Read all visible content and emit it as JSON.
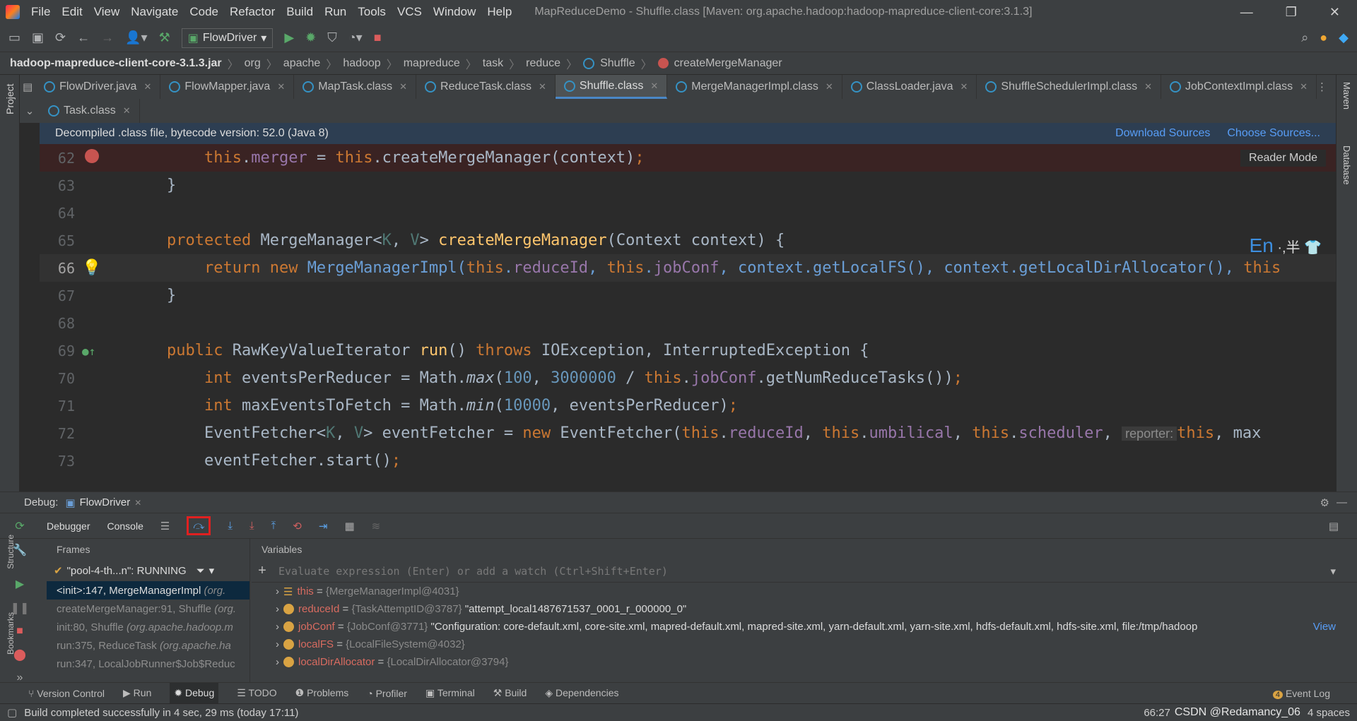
{
  "app": {
    "title": "MapReduceDemo - Shuffle.class [Maven: org.apache.hadoop:hadoop-mapreduce-client-core:3.1.3]",
    "menu": [
      "File",
      "Edit",
      "View",
      "Navigate",
      "Code",
      "Refactor",
      "Build",
      "Run",
      "Tools",
      "VCS",
      "Window",
      "Help"
    ]
  },
  "toolbar": {
    "run_config": "FlowDriver"
  },
  "breadcrumb": [
    "hadoop-mapreduce-client-core-3.1.3.jar",
    "org",
    "apache",
    "hadoop",
    "mapreduce",
    "task",
    "reduce",
    "Shuffle",
    "createMergeManager"
  ],
  "tabs": [
    {
      "label": "FlowDriver.java"
    },
    {
      "label": "FlowMapper.java"
    },
    {
      "label": "MapTask.class"
    },
    {
      "label": "ReduceTask.class"
    },
    {
      "label": "Shuffle.class",
      "active": true
    },
    {
      "label": "MergeManagerImpl.class"
    },
    {
      "label": "ClassLoader.java"
    },
    {
      "label": "ShuffleSchedulerImpl.class"
    },
    {
      "label": "JobContextImpl.class"
    }
  ],
  "tabs_row2": [
    {
      "label": "Task.class"
    }
  ],
  "info": {
    "text": "Decompiled .class file, bytecode version: 52.0 (Java 8)",
    "download": "Download Sources",
    "choose": "Choose Sources...",
    "reader": "Reader Mode"
  },
  "side": {
    "project": "Project",
    "maven": "Maven",
    "database": "Database",
    "structure": "Structure",
    "bookmarks": "Bookmarks"
  },
  "editor": {
    "ime": "En",
    "line_numbers": [
      "62",
      "63",
      "64",
      "65",
      "66",
      "67",
      "68",
      "69",
      "70",
      "71",
      "72",
      "73"
    ]
  },
  "debug": {
    "label": "Debug:",
    "session": "FlowDriver",
    "tab_debugger": "Debugger",
    "tab_console": "Console",
    "frames_label": "Frames",
    "variables_label": "Variables",
    "thread": "\"pool-4-th...n\": RUNNING",
    "frames": [
      {
        "method": "<init>:147, MergeManagerImpl",
        "pkg": "(org."
      },
      {
        "method": "createMergeManager:91, Shuffle",
        "pkg": "(org."
      },
      {
        "method": "init:80, Shuffle",
        "pkg": "(org.apache.hadoop.m"
      },
      {
        "method": "run:375, ReduceTask",
        "pkg": "(org.apache.ha"
      },
      {
        "method": "run:347, LocalJobRunner$Job$Reduc",
        "pkg": ""
      }
    ],
    "watch_placeholder": "Evaluate expression (Enter) or add a watch (Ctrl+Shift+Enter)",
    "variables": [
      {
        "name": "this",
        "eq": "=",
        "type": "{MergeManagerImpl@4031}",
        "value": ""
      },
      {
        "name": "reduceId",
        "eq": "=",
        "type": "{TaskAttemptID@3787}",
        "value": "\"attempt_local1487671537_0001_r_000000_0\""
      },
      {
        "name": "jobConf",
        "eq": "=",
        "type": "{JobConf@3771}",
        "value": "\"Configuration: core-default.xml, core-site.xml, mapred-default.xml, mapred-site.xml, yarn-default.xml, yarn-site.xml, hdfs-default.xml, hdfs-site.xml, file:/tmp/hadoop"
      },
      {
        "name": "localFS",
        "eq": "=",
        "type": "{LocalFileSystem@4032}",
        "value": ""
      },
      {
        "name": "localDirAllocator",
        "eq": "=",
        "type": "{LocalDirAllocator@3794}",
        "value": ""
      }
    ],
    "view_link": "View"
  },
  "bottom_tabs": [
    "Version Control",
    "Run",
    "Debug",
    "TODO",
    "Problems",
    "Profiler",
    "Terminal",
    "Build",
    "Dependencies"
  ],
  "event_log": "Event Log",
  "event_count": "4",
  "status": {
    "message": "Build completed successfully in 4 sec, 29 ms (today 17:11)",
    "position": "66:27",
    "indent": "4 spaces",
    "watermark": "CSDN @Redamancy_06"
  }
}
